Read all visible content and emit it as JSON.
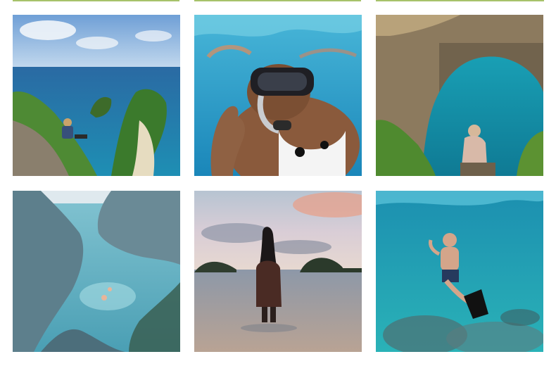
{
  "colors": {
    "accent": "#a7c26a",
    "background": "#ffffff"
  },
  "gallery": {
    "photos": [
      {
        "id": "kelingking-cliff",
        "subject": "landscape-image"
      },
      {
        "id": "snorkel-selfie",
        "subject": "underwater-image"
      },
      {
        "id": "broken-beach-arch",
        "subject": "landscape-image"
      },
      {
        "id": "angel-billabong-pool",
        "subject": "landscape-image"
      },
      {
        "id": "sunset-beach",
        "subject": "landscape-image"
      },
      {
        "id": "underwater-freediver",
        "subject": "underwater-image"
      }
    ]
  }
}
